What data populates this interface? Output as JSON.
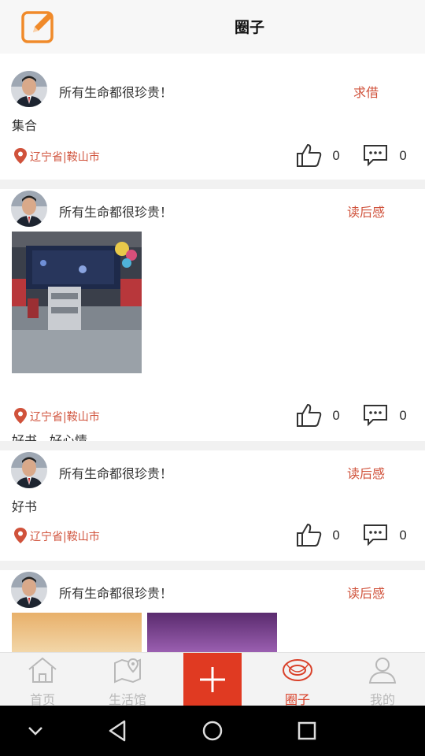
{
  "header": {
    "title": "圈子",
    "edit_icon": "edit-square-icon"
  },
  "colors": {
    "accent": "#e03a22",
    "tag": "#d0523b",
    "inactive": "#b8b8b8"
  },
  "posts": [
    {
      "username": "所有生命都很珍贵！",
      "tag": "求借",
      "text": "集合",
      "location": "辽宁省|鞍山市",
      "likes": "0",
      "comments": "0"
    },
    {
      "username": "所有生命都很珍贵！",
      "tag": "读后感",
      "text": "好书，好心情。",
      "location": "辽宁省|鞍山市",
      "likes": "0",
      "comments": "0"
    },
    {
      "username": "所有生命都很珍贵！",
      "tag": "读后感",
      "text": "好书",
      "location": "辽宁省|鞍山市",
      "likes": "0",
      "comments": "0"
    },
    {
      "username": "所有生命都很珍贵！",
      "tag": "读后感"
    }
  ],
  "tabbar": {
    "tabs": [
      {
        "label": "首页",
        "icon": "home-icon"
      },
      {
        "label": "生活馆",
        "icon": "map-pin-icon"
      },
      {
        "label": "圈子",
        "icon": "circle-eye-icon",
        "active": true
      },
      {
        "label": "我的",
        "icon": "user-icon"
      }
    ],
    "add_icon": "plus-icon"
  },
  "navbar": {
    "icons": [
      "chevron-down-icon",
      "back-icon",
      "home-circle-icon",
      "recents-icon"
    ]
  }
}
